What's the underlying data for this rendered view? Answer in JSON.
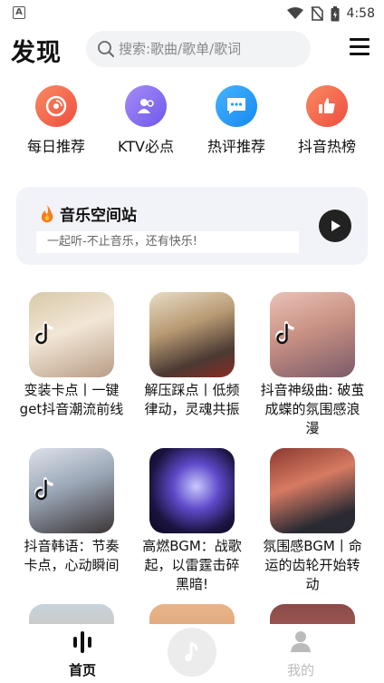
{
  "status_bar": {
    "time": "4:58",
    "left_icon_letter": "A"
  },
  "header": {
    "title": "发现",
    "search_placeholder": "搜索:歌曲/歌单/歌词"
  },
  "shortcuts": [
    {
      "label": "每日推荐",
      "icon": "vinyl-icon",
      "color": "#f4684c"
    },
    {
      "label": "KTV必点",
      "icon": "users-icon",
      "color": "#8a6cf0"
    },
    {
      "label": "热评推荐",
      "icon": "comment-icon",
      "color": "#2a9cf7"
    },
    {
      "label": "抖音热榜",
      "icon": "thumbs-up-icon",
      "color": "#f4684c"
    }
  ],
  "music_station": {
    "title": "音乐空间站",
    "subtitle": "一起听-不止音乐，还有快乐!"
  },
  "playlists": [
    {
      "title": "变装卡点丨一键get抖音潮流前线",
      "has_tiktok_badge": true
    },
    {
      "title": "解压踩点丨低频律动，灵魂共振",
      "has_tiktok_badge": false
    },
    {
      "title": "抖音神级曲: 破茧成蝶的氛围感浪漫",
      "has_tiktok_badge": true
    },
    {
      "title": "抖音韩语：节奏卡点，心动瞬间",
      "has_tiktok_badge": true
    },
    {
      "title": "高燃BGM：战歌起，以雷霆击碎黑暗!",
      "has_tiktok_badge": false
    },
    {
      "title": "氛围感BGM丨命运的齿轮开始转动",
      "has_tiktok_badge": false
    },
    {
      "title": "",
      "has_tiktok_badge": false
    },
    {
      "title": "",
      "has_tiktok_badge": false
    },
    {
      "title": "",
      "has_tiktok_badge": false
    }
  ],
  "tabbar": {
    "home_label": "首页",
    "mine_label": "我的",
    "active_color": "#111111",
    "inactive_color": "#bbbbbb"
  }
}
